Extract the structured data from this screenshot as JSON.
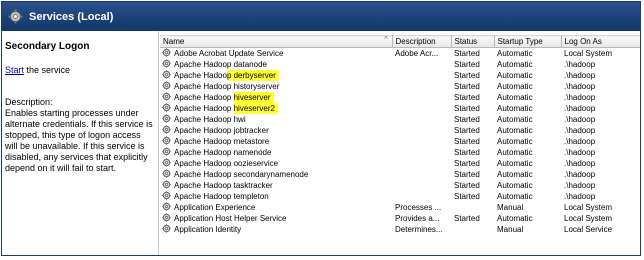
{
  "window": {
    "title": "Services (Local)"
  },
  "detail": {
    "service_name": "Secondary Logon",
    "start_link": "Start",
    "start_suffix": " the service",
    "description_label": "Description:",
    "description_text": "Enables starting processes under alternate credentials. If this service is stopped, this type of logon access will be unavailable. If this service is disabled, any services that explicitly depend on it will fail to start."
  },
  "table": {
    "columns": [
      "Name",
      "Description",
      "Status",
      "Startup Type",
      "Log On As"
    ],
    "rows": [
      {
        "prefix": "Adobe Acrobat Update Service",
        "highlight": "",
        "description": "Adobe Acr...",
        "status": "Started",
        "startup": "Automatic",
        "logon": "Local System"
      },
      {
        "prefix": "Apache Hadoop datanode",
        "highlight": "",
        "description": "",
        "status": "Started",
        "startup": "Automatic",
        "logon": ".\\hadoop"
      },
      {
        "prefix": "Apache Hadoo",
        "highlight": "p derbyserver",
        "description": "",
        "status": "Started",
        "startup": "Automatic",
        "logon": ".\\hadoop"
      },
      {
        "prefix": "Apache Hadoop historyserver",
        "highlight": "",
        "description": "",
        "status": "Started",
        "startup": "Automatic",
        "logon": ".\\hadoop"
      },
      {
        "prefix": "Apache Hadoop ",
        "highlight": "hiveserver",
        "description": "",
        "status": "Started",
        "startup": "Automatic",
        "logon": ".\\hadoop"
      },
      {
        "prefix": "Apache Hadoop ",
        "highlight": "hiveserver2",
        "description": "",
        "status": "Started",
        "startup": "Automatic",
        "logon": ".\\hadoop"
      },
      {
        "prefix": "Apache Hadoop hwi",
        "highlight": "",
        "description": "",
        "status": "Started",
        "startup": "Automatic",
        "logon": ".\\hadoop"
      },
      {
        "prefix": "Apache Hadoop jobtracker",
        "highlight": "",
        "description": "",
        "status": "Started",
        "startup": "Automatic",
        "logon": ".\\hadoop"
      },
      {
        "prefix": "Apache Hadoop metastore",
        "highlight": "",
        "description": "",
        "status": "Started",
        "startup": "Automatic",
        "logon": ".\\hadoop"
      },
      {
        "prefix": "Apache Hadoop namenode",
        "highlight": "",
        "description": "",
        "status": "Started",
        "startup": "Automatic",
        "logon": ".\\hadoop"
      },
      {
        "prefix": "Apache Hadoop oozieservice",
        "highlight": "",
        "description": "",
        "status": "Started",
        "startup": "Automatic",
        "logon": ".\\hadoop"
      },
      {
        "prefix": "Apache Hadoop secondarynamenode",
        "highlight": "",
        "description": "",
        "status": "Started",
        "startup": "Automatic",
        "logon": ".\\hadoop"
      },
      {
        "prefix": "Apache Hadoop tasktracker",
        "highlight": "",
        "description": "",
        "status": "Started",
        "startup": "Automatic",
        "logon": ".\\hadoop"
      },
      {
        "prefix": "Apache Hadoop templeton",
        "highlight": "",
        "description": "",
        "status": "Started",
        "startup": "Automatic",
        "logon": ".\\hadoop"
      },
      {
        "prefix": "Application Experience",
        "highlight": "",
        "description": "Processes ...",
        "status": "",
        "startup": "Manual",
        "logon": "Local System"
      },
      {
        "prefix": "Application Host Helper Service",
        "highlight": "",
        "description": "Provides a...",
        "status": "Started",
        "startup": "Automatic",
        "logon": "Local System"
      },
      {
        "prefix": "Application Identity",
        "highlight": "",
        "description": "Determines...",
        "status": "",
        "startup": "Manual",
        "logon": "Local Service"
      }
    ]
  },
  "colors": {
    "titlebar": "#1e4580",
    "highlight": "#ffff33",
    "link": "#0000cc"
  },
  "icons": {
    "title": "services-gear-icon",
    "row": "service-gear-icon",
    "sort": "sort-caret-icon"
  }
}
